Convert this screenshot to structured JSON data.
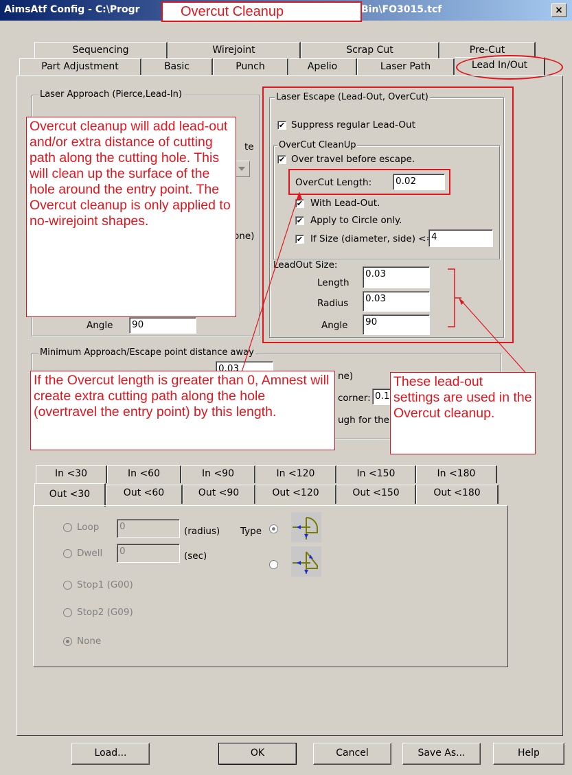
{
  "window": {
    "title_left": "AimsAtf Config - C:\\Progr",
    "title_right": "Bin\\FO3015.tcf",
    "close": "×",
    "overlay_title": "Overcut Cleanup"
  },
  "tabs_row1": [
    "Sequencing",
    "Wirejoint",
    "Scrap Cut",
    "Pre-Cut"
  ],
  "tabs_row2": [
    "Part Adjustment",
    "Basic",
    "Punch",
    "Apelio",
    "Laser Path",
    "Lead In/Out"
  ],
  "approach": {
    "legend": "Laser Approach (Pierce,Lead-In)",
    "partial_te": "te",
    "partial_one": "one)",
    "angle_label": "Angle",
    "angle_value": "90"
  },
  "escape": {
    "legend": "Laser Escape (Lead-Out, OverCut)",
    "suppress_label": "Suppress regular Lead-Out",
    "overcut_legend": "OverCut CleanUp",
    "over_travel_label": "Over travel before escape.",
    "overcut_length_label": "OverCut Length:",
    "overcut_length_value": "0.02",
    "with_leadout_label": "With Lead-Out.",
    "circle_only_label": "Apply to Circle only.",
    "if_size_label": "If Size (diameter, side)  <=",
    "if_size_value": "4",
    "leadout_size_legend": "LeadOut Size:",
    "length_label": "Length",
    "length_value": "0.03",
    "radius_label": "Radius",
    "radius_value": "0.03",
    "angle_label": "Angle",
    "angle_value": "90"
  },
  "min_distance": {
    "legend": "Minimum Approach/Escape point distance away",
    "frag1": "0.03",
    "frag2": "ne)",
    "frag3": "corner:",
    "frag4": "0.1",
    "frag5": "ugh for the"
  },
  "angle_tabs_row1": [
    "In <30",
    "In <60",
    "In <90",
    "In <120",
    "In <150",
    "In <180"
  ],
  "angle_tabs_row2": [
    "Out <30",
    "Out <60",
    "Out <90",
    "Out <120",
    "Out <150",
    "Out <180"
  ],
  "leadout_opts": {
    "loop_label": "Loop",
    "loop_value": "0",
    "loop_unit": "(radius)",
    "type_label": "Type",
    "dwell_label": "Dwell",
    "dwell_value": "0",
    "dwell_unit": "(sec)",
    "stop1_label": "Stop1 (G00)",
    "stop2_label": "Stop2 (G09)",
    "none_label": "None"
  },
  "buttons": {
    "load": "Load...",
    "ok": "OK",
    "cancel": "Cancel",
    "save_as": "Save As...",
    "help": "Help"
  },
  "annotations": {
    "overcut_note": "Overcut cleanup will add lead-out and/or extra distance of cutting path along the cutting hole.  This will clean up the surface of the hole around the entry point.  The Overcut cleanup is only applied to no-wirejoint shapes.",
    "length_note": "If the Overcut length is greater than 0, Amnest will create extra cutting path along the hole (overtravel the entry point) by this length.",
    "settings_note": "These lead-out settings are used in the Overcut cleanup."
  },
  "colors": {
    "dialog_bg": "#d4d0c8",
    "title_gradient_start": "#0a246a",
    "annotation_red": "#e0161e",
    "icon_bg": "#c8c8c8",
    "icon_line": "#7a7a00",
    "icon_arrow": "#1b2fd6"
  },
  "icons": {
    "type_option1": "lead-out-arc-icon",
    "type_option2": "lead-out-line-icon"
  }
}
